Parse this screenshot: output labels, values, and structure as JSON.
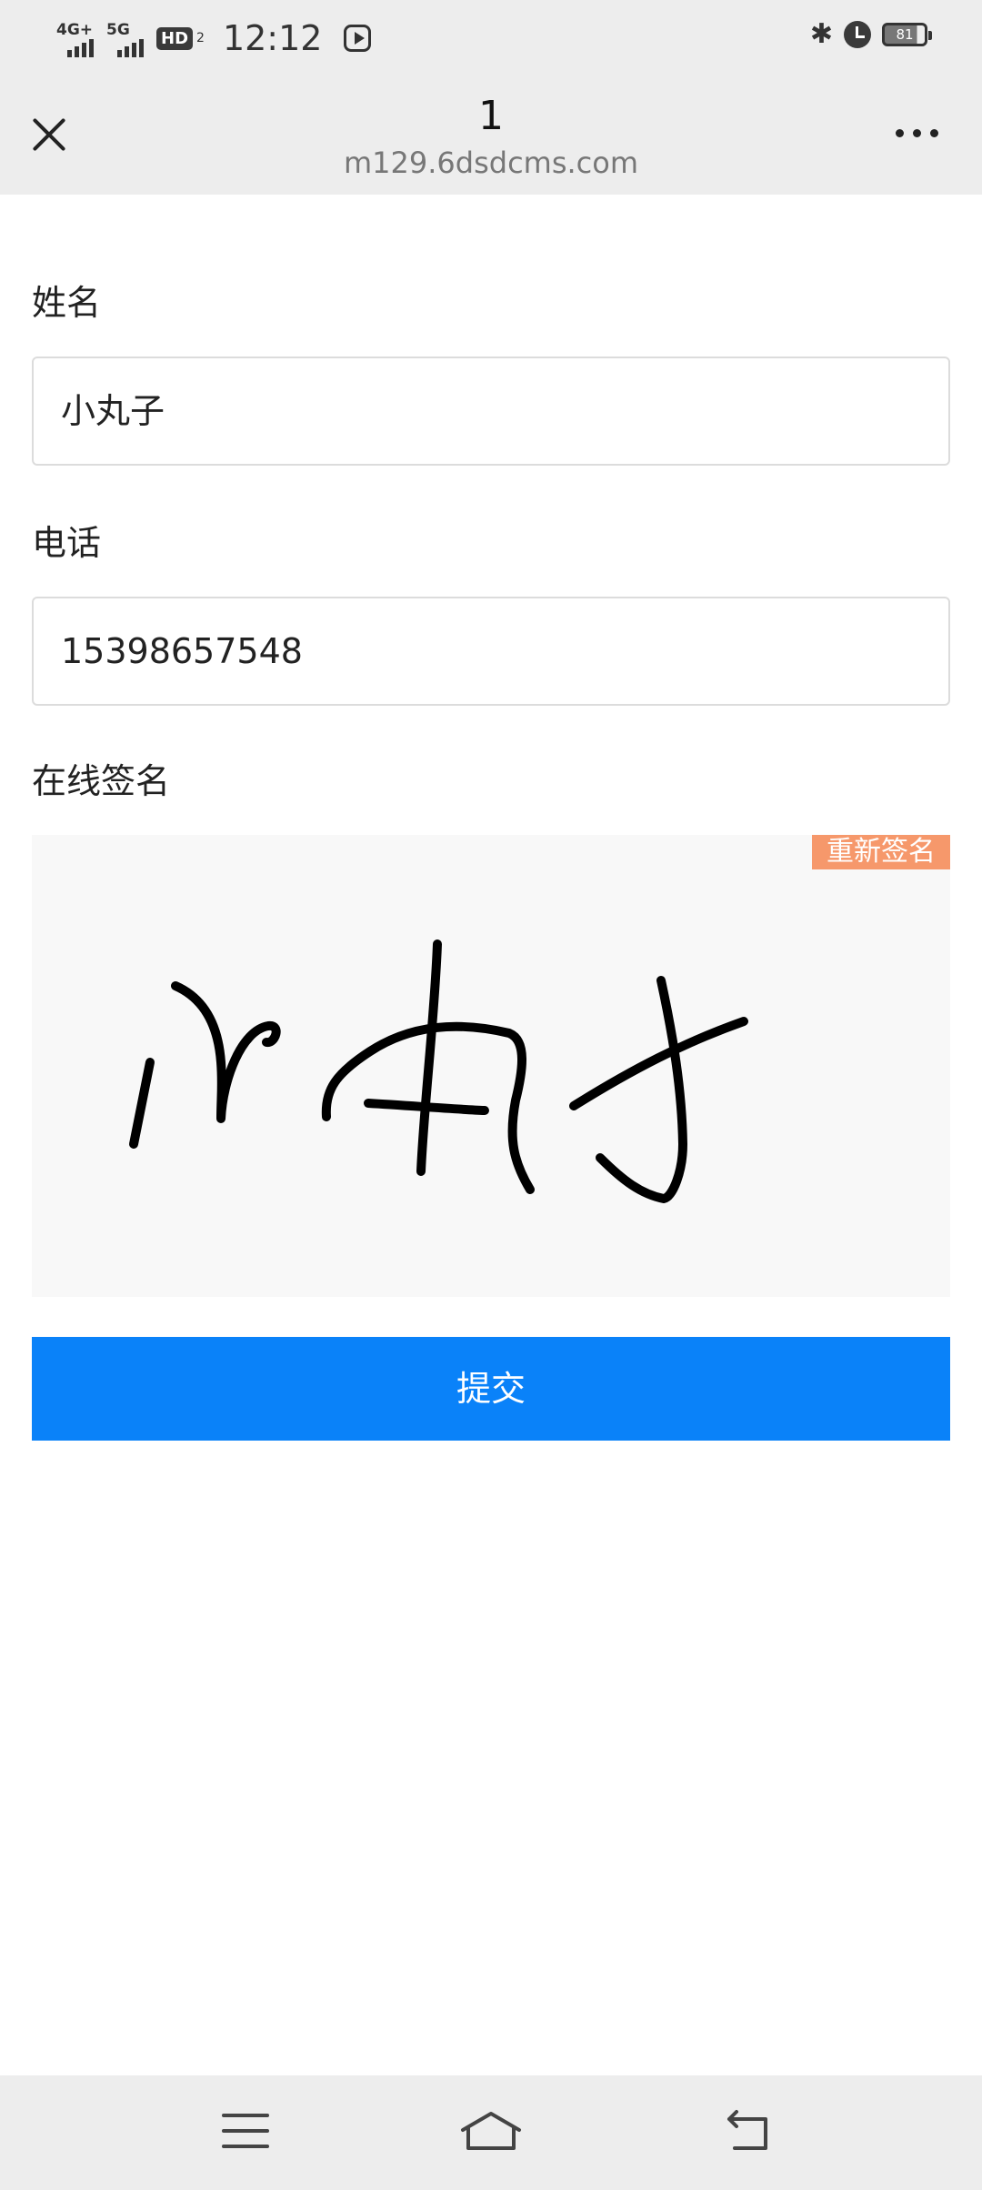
{
  "status_bar": {
    "network1": "4G+",
    "network2": "5G",
    "hd_badge": "HD",
    "hd_sub": "2",
    "time": "12:12",
    "battery": "81"
  },
  "nav": {
    "title": "1",
    "url": "m129.6dsdcms.com"
  },
  "form": {
    "name_label": "姓名",
    "name_value": "小丸子",
    "phone_label": "电话",
    "phone_value": "15398657548",
    "signature_label": "在线签名",
    "resign_label": "重新签名",
    "submit_label": "提交"
  },
  "colors": {
    "accent": "#0a82f9",
    "resign": "#f6986b",
    "bar_bg": "#ededed"
  }
}
